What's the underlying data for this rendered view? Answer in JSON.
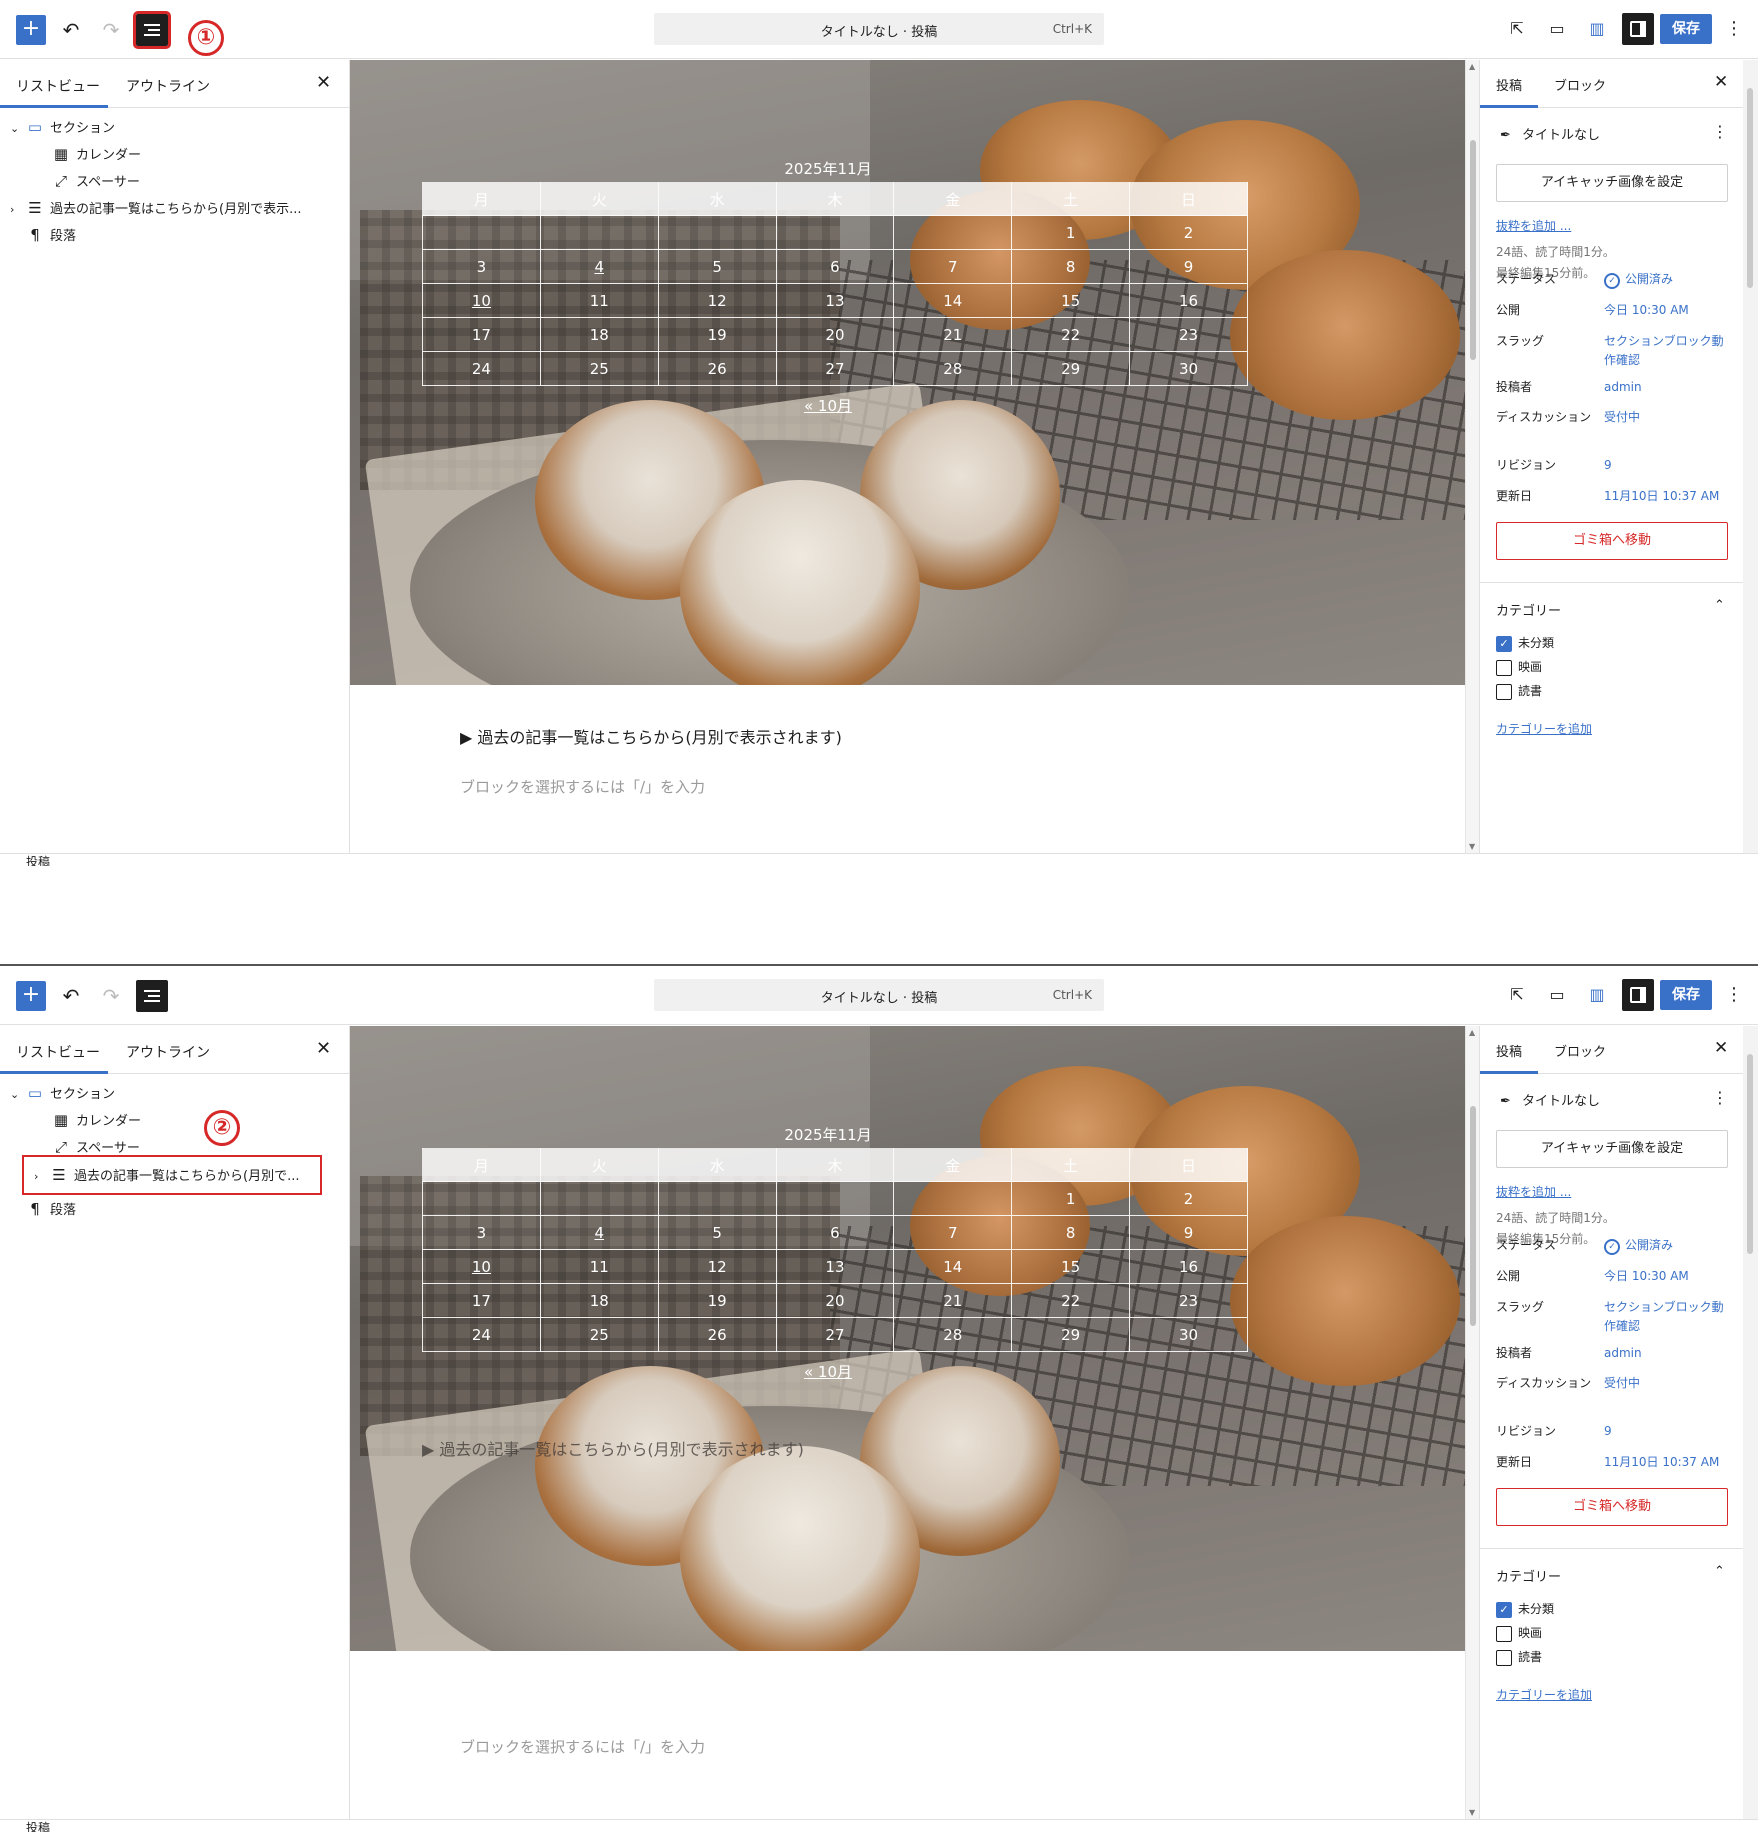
{
  "toolbar": {
    "add_icon": "plus-icon",
    "undo_icon": "undo-icon",
    "redo_icon": "redo-icon",
    "list_view_icon": "list-view-icon",
    "document_title": "タイトルなし · 投稿",
    "shortcut": "Ctrl+K",
    "view_icon": "external-link-icon",
    "preview_icon": "desktop-icon",
    "book_icon": "book-icon",
    "settings_icon": "sidebar-toggle-icon",
    "save_label": "保存",
    "more_icon": "more-vertical-icon",
    "accent_color": "#3a71c8"
  },
  "annotations": {
    "step1": "①",
    "step2": "②",
    "marker_color": "#d62828"
  },
  "left_sidebar": {
    "tabs": [
      "リストビュー",
      "アウトライン"
    ],
    "close_icon": "close-icon",
    "tree_panel1": [
      {
        "label": "セクション",
        "icon": "section-icon"
      },
      {
        "label": "カレンダー",
        "icon": "calendar-icon"
      },
      {
        "label": "スペーサー",
        "icon": "spacer-icon"
      },
      {
        "label": "過去の記事一覧はこちらから(月別で表示...",
        "icon": "details-icon"
      },
      {
        "label": "段落",
        "icon": "paragraph-icon"
      }
    ],
    "tree_panel2": [
      {
        "label": "セクション",
        "icon": "section-icon"
      },
      {
        "label": "カレンダー",
        "icon": "calendar-icon"
      },
      {
        "label": "スペーサー",
        "icon": "spacer-icon"
      },
      {
        "label": "過去の記事一覧はこちらから(月別で...",
        "icon": "details-icon"
      },
      {
        "label": "段落",
        "icon": "paragraph-icon"
      }
    ]
  },
  "calendar": {
    "caption": "2025年11月",
    "weekdays": [
      "月",
      "火",
      "水",
      "木",
      "金",
      "土",
      "日"
    ],
    "weeks": [
      [
        "",
        "",
        "",
        "",
        "",
        "1",
        "2"
      ],
      [
        "3",
        "4",
        "5",
        "6",
        "7",
        "8",
        "9"
      ],
      [
        "10",
        "11",
        "12",
        "13",
        "14",
        "15",
        "16"
      ],
      [
        "17",
        "18",
        "19",
        "20",
        "21",
        "22",
        "23"
      ],
      [
        "24",
        "25",
        "26",
        "27",
        "28",
        "29",
        "30"
      ]
    ],
    "linked_days": [
      "4",
      "10"
    ],
    "prev_link": "« 10月"
  },
  "content": {
    "details_summary": "▶ 過去の記事一覧はこちらから(月別で表示されます)",
    "details_summary_overlay": "▶ 過去の記事一覧はこちらから(月別で表示されます)",
    "placeholder": "ブロックを選択するには「/」を入力"
  },
  "right_sidebar": {
    "tabs": [
      "投稿",
      "ブロック"
    ],
    "post_title": "タイトルなし",
    "featured_image_button": "アイキャッチ画像を設定",
    "excerpt_link": "抜粋を追加 ...",
    "word_count": "24語、読了時間1分。",
    "last_edited": "最終編集15分前。",
    "meta": [
      {
        "key": "ステータス",
        "value": "公開済み"
      },
      {
        "key": "公開",
        "value": "今日 10:30 AM"
      },
      {
        "key": "スラッグ",
        "value": "セクションブロック動作確認"
      },
      {
        "key": "投稿者",
        "value": "admin"
      },
      {
        "key": "ディスカッション",
        "value": "受付中"
      },
      {
        "key": "リビジョン",
        "value": "9"
      },
      {
        "key": "更新日",
        "value": "11月10日 10:37 AM"
      }
    ],
    "trash_button": "ゴミ箱へ移動",
    "categories_title": "カテゴリー",
    "categories": [
      {
        "label": "未分類",
        "checked": true
      },
      {
        "label": "映画",
        "checked": false
      },
      {
        "label": "読書",
        "checked": false
      }
    ],
    "add_category_link": "カテゴリーを追加"
  },
  "footer": {
    "breadcrumb": "投稿"
  }
}
